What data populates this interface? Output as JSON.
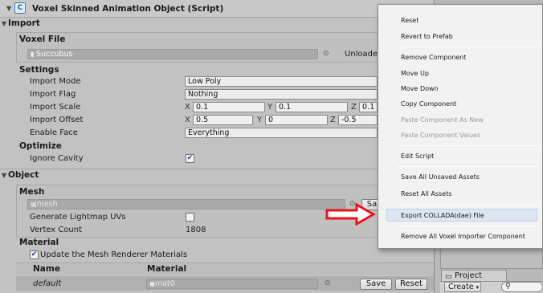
{
  "inspector": {
    "component_title": "Voxel Skinned Animation Object (Script)",
    "import_header": "Import",
    "voxel_file": {
      "header": "Voxel File",
      "value": "Succubus",
      "unload_label": "Unloade"
    },
    "settings": {
      "header": "Settings",
      "import_mode_label": "Import Mode",
      "import_mode_value": "Low Poly",
      "import_flag_label": "Import Flag",
      "import_flag_value": "Nothing",
      "import_scale_label": "Import Scale",
      "import_scale": {
        "x": "0.1",
        "y": "0.1",
        "z": "0.1"
      },
      "import_offset_label": "Import Offset",
      "import_offset": {
        "x": "0.5",
        "y": "0",
        "z": "-0.5"
      },
      "enable_face_label": "Enable Face",
      "enable_face_value": "Everything",
      "axis_x": "X",
      "axis_y": "Y",
      "axis_z": "Z"
    },
    "optimize": {
      "header": "Optimize",
      "ignore_cavity_label": "Ignore Cavity",
      "ignore_cavity_checked": "✔"
    },
    "object_header": "Object",
    "mesh": {
      "header": "Mesh",
      "value": "mesh",
      "save_button": "Sa",
      "generate_lightmap_label": "Generate Lightmap UVs",
      "vertex_count_label": "Vertex Count",
      "vertex_count_value": "1808"
    },
    "material": {
      "header": "Material",
      "update_renderer_label": "Update the Mesh Renderer Materials",
      "update_renderer_checked": "✔",
      "col_name": "Name",
      "col_material": "Material",
      "row_name": "default",
      "row_material": "mat0",
      "save_button": "Save",
      "reset_button": "Reset"
    }
  },
  "context_menu": {
    "items": [
      {
        "label": "Reset",
        "disabled": false
      },
      {
        "label": "Revert to Prefab",
        "disabled": false
      },
      {
        "label": "Remove Component",
        "disabled": false
      },
      {
        "label": "Move Up",
        "disabled": false
      },
      {
        "label": "Move Down",
        "disabled": false
      },
      {
        "label": "Copy Component",
        "disabled": false
      },
      {
        "label": "Paste Component As New",
        "disabled": true
      },
      {
        "label": "Paste Component Values",
        "disabled": true
      },
      {
        "label": "Edit Script",
        "disabled": false
      },
      {
        "label": "Save All Unsaved Assets",
        "disabled": false
      },
      {
        "label": "Reset All Assets",
        "disabled": false
      },
      {
        "label": "Export COLLADA(dae) File",
        "disabled": false,
        "highlighted": true
      },
      {
        "label": "Remove All Voxel Importer Component",
        "disabled": false
      }
    ]
  },
  "project_panel": {
    "tab_label": "Project",
    "create_label": "Create"
  },
  "colors": {
    "inspector_bg": "#c2c2c2",
    "menu_bg": "#f2f2f2",
    "highlight": "#dde6f2",
    "arrow": "#e8151b"
  }
}
